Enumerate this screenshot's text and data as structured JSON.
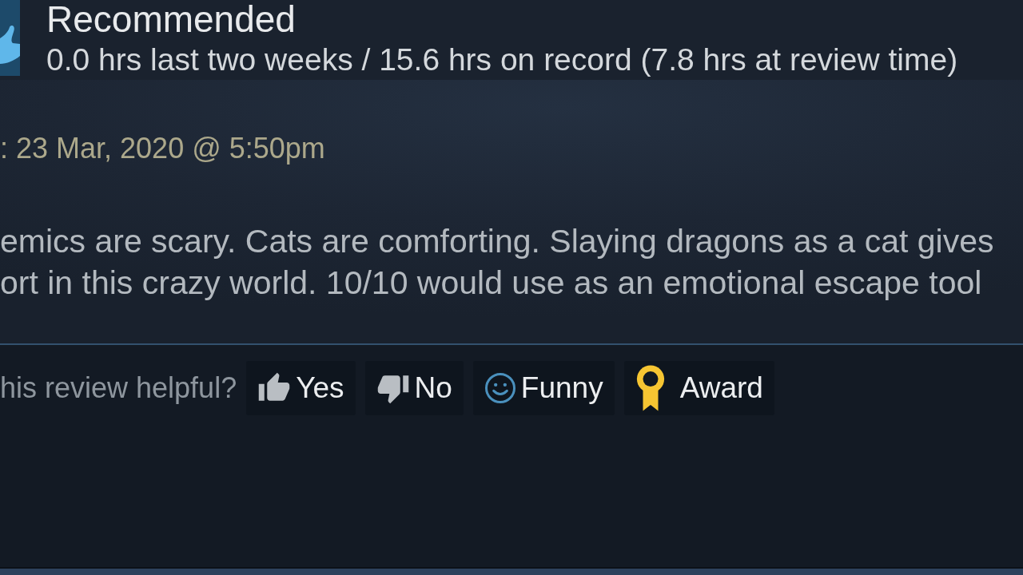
{
  "review": {
    "verdict": "Recommended",
    "hours": "0.0 hrs last two weeks / 15.6 hrs on record (7.8 hrs at review time)",
    "posted": ": 23 Mar, 2020 @ 5:50pm",
    "body": "emics are scary. Cats are comforting. Slaying dragons as a cat gives\nort in this crazy world. 10/10 would use as an emotional escape tool",
    "helpful_prompt": "his review helpful?",
    "buttons": [
      {
        "kind": "thumbs_up",
        "label": "Yes"
      },
      {
        "kind": "thumbs_down",
        "label": "No"
      },
      {
        "kind": "smiley",
        "label": "Funny"
      },
      {
        "kind": "award",
        "label": "Award"
      }
    ]
  }
}
